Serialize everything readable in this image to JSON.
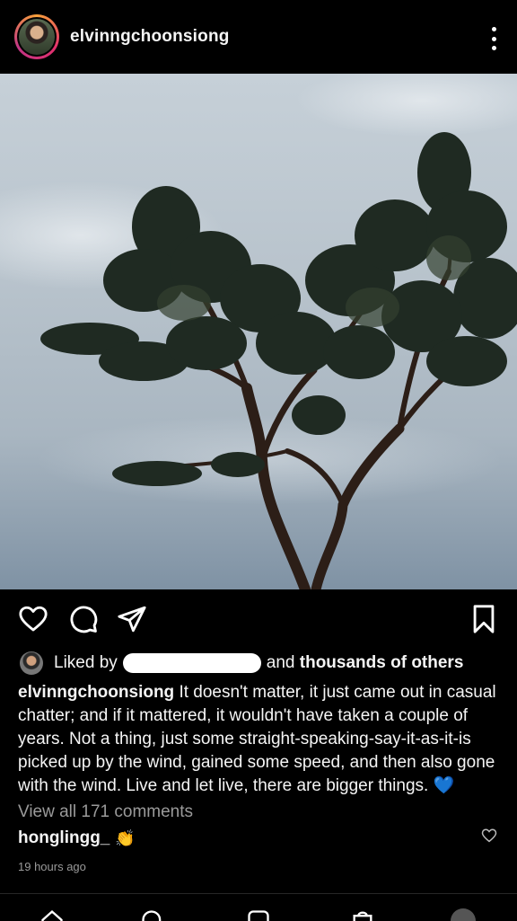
{
  "post": {
    "username": "elvinngchoonsiong",
    "liked_by_prefix": "Liked by",
    "liked_by_suffix": "and",
    "liked_by_others": "thousands of others",
    "caption_username": "elvinngchoonsiong",
    "caption_text": " It doesn't matter, it just came out in casual chatter; and if it mattered, it wouldn't have taken a couple of years. Not a thing, just some straight-speaking-say-it-as-it-is picked up by the wind, gained some speed, and then also gone with the wind. Live and let live, there are bigger things. ",
    "caption_emoji": "💙",
    "view_comments": "View all 171 comments",
    "comment_username": "honglingg_",
    "comment_emoji": "👏",
    "timestamp": "19 hours ago"
  },
  "icons": {
    "more": "more-options-icon",
    "like": "heart-icon",
    "comment": "comment-icon",
    "share": "send-icon",
    "save": "bookmark-icon"
  },
  "colors": {
    "background": "#000000",
    "text": "#f5f5f5",
    "muted": "#9a9a9a",
    "heart_blue": "#3aa0ff"
  }
}
